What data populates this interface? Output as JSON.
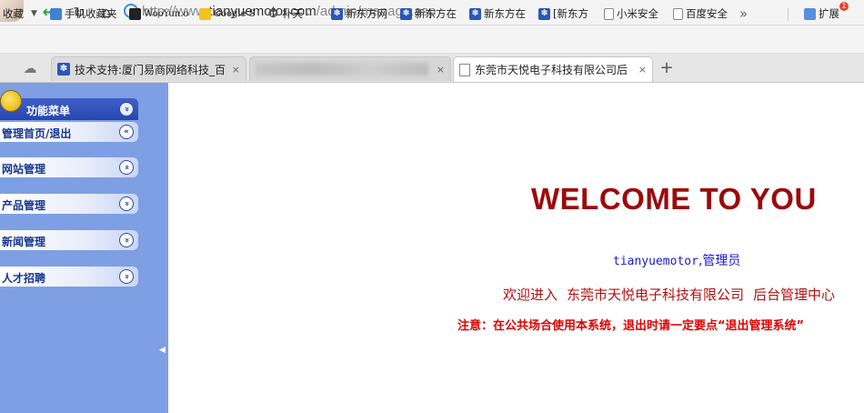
{
  "browser": {
    "url": {
      "scheme": "http://www.",
      "host": "tianyuemotor.com",
      "path": "/admin/manage.asp"
    },
    "bookmarks_label": "收藏",
    "bookmarks": [
      {
        "label": "手机收藏夹",
        "icon": "phone-icon"
      },
      {
        "label": "WooYun.o",
        "icon": "wooyun-icon"
      },
      {
        "label": "Google S",
        "icon": "google-icon"
      },
      {
        "label": "补天 -",
        "icon": "star-icon"
      },
      {
        "label": "新东方网",
        "icon": "paw-icon"
      },
      {
        "label": "新东方在",
        "icon": "paw-icon"
      },
      {
        "label": "新东方在",
        "icon": "paw-icon"
      },
      {
        "label": "[新东方",
        "icon": "paw-icon"
      },
      {
        "label": "小米安全",
        "icon": "page-icon"
      },
      {
        "label": "百度安全",
        "icon": "page-icon"
      }
    ],
    "more_label": "»",
    "extensions_label": "扩展",
    "extensions_badge": "1",
    "tabs": [
      {
        "title": "技术支持:厦门易商网络科技_百",
        "icon": "paw-icon"
      },
      {
        "title": "",
        "icon": "blurred"
      },
      {
        "title": "东莞市天悦电子科技有限公司后",
        "icon": "page-icon"
      }
    ],
    "new_tab_label": "+",
    "close_label": "×"
  },
  "sidebar": {
    "header": "功能菜单",
    "header_chevron": "»",
    "items": [
      {
        "label": "管理首页/退出",
        "chevron": "«"
      },
      {
        "label": "网站管理",
        "chevron": "«"
      },
      {
        "label": "产品管理",
        "chevron": "»"
      },
      {
        "label": "新闻管理",
        "chevron": "»"
      },
      {
        "label": "人才招聘",
        "chevron": "»"
      }
    ],
    "toggle_glyph": "◀"
  },
  "main": {
    "welcome": "WELCOME TO YOU",
    "username": "tianyuemotor",
    "role": ",管理员",
    "enter_prefix": "欢迎进入",
    "company": "东莞市天悦电子科技有限公司",
    "center": "后台管理中心",
    "notice": "注意：在公共场合使用本系统，退出时请一定要点“退出管理系统”"
  },
  "colors": {
    "sidebar_bg": "#7e9fe3",
    "menu_header": "#2846b0",
    "welcome": "#9b0a0a",
    "notice": "#e00000",
    "user_text": "#1a1acc"
  }
}
